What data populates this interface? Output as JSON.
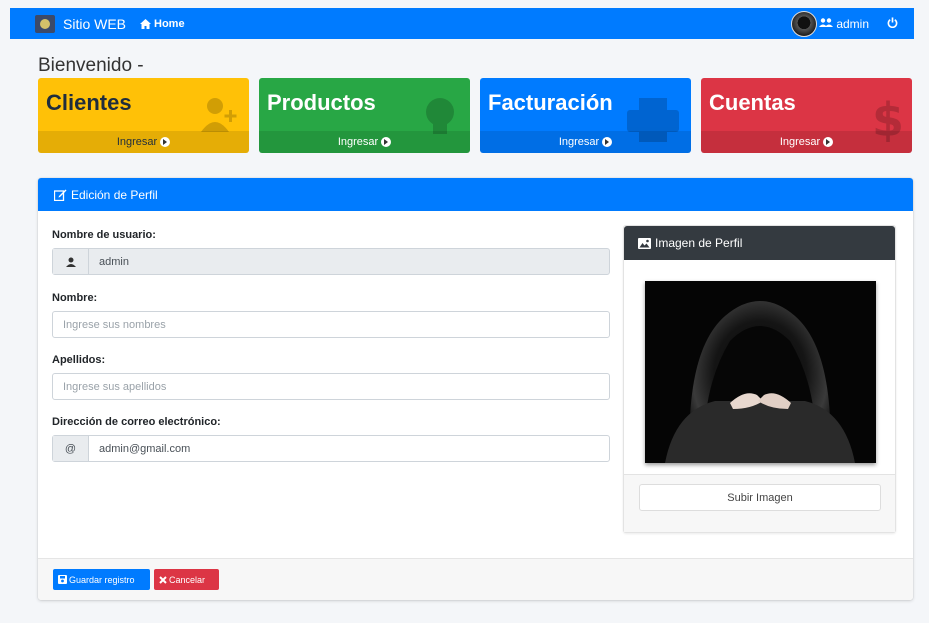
{
  "navbar": {
    "brand": "Sitio WEB",
    "home": "Home",
    "user": "admin"
  },
  "welcome": "Bienvenido -",
  "cards": [
    {
      "title": "Clientes",
      "link": "Ingresar",
      "icon": "user-plus-icon",
      "color": "#ffc107"
    },
    {
      "title": "Productos",
      "link": "Ingresar",
      "icon": "lightbulb-icon",
      "color": "#28a745"
    },
    {
      "title": "Facturación",
      "link": "Ingresar",
      "icon": "print-icon",
      "color": "#007bff"
    },
    {
      "title": "Cuentas",
      "link": "Ingresar",
      "icon": "dollar-icon",
      "color": "#dc3545"
    }
  ],
  "profile": {
    "header": "Edición de Perfil",
    "username_label": "Nombre de usuario:",
    "username_value": "admin",
    "name_label": "Nombre:",
    "name_placeholder": "Ingrese sus nombres",
    "surname_label": "Apellidos:",
    "surname_placeholder": "Ingrese sus apellidos",
    "email_label": "Dirección de correo electrónico:",
    "email_addon": "@",
    "email_value": "admin@gmail.com"
  },
  "image_card": {
    "header": "Imagen de Perfil",
    "upload_button": "Subir Imagen"
  },
  "actions": {
    "save": "Guardar registro",
    "cancel": "Cancelar"
  }
}
